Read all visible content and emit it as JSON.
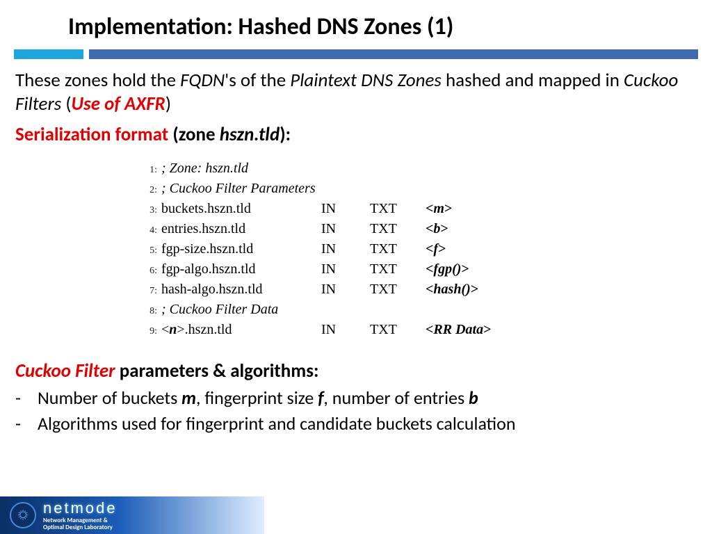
{
  "title": "Implementation: Hashed DNS Zones (1)",
  "intro": {
    "t1": "These zones hold the ",
    "fqdn": "FQDN",
    "t2": "'s of the ",
    "pdz": "Plaintext DNS Zones",
    "t3": " hashed and mapped in ",
    "cf": "Cuckoo Filters",
    "t4": " (",
    "axfr": "Use of AXFR",
    "t5": ")"
  },
  "subhead": {
    "s1": "Serialization format",
    "s2": " (zone ",
    "zone": "hszn.tld",
    "s3": "):"
  },
  "records": [
    {
      "n": "1",
      "comment": true,
      "name": "; Zone: hszn.tld"
    },
    {
      "n": "2",
      "comment": true,
      "name": "; Cuckoo Filter Parameters"
    },
    {
      "n": "3",
      "name": "buckets.hszn.tld",
      "cls": "IN",
      "typ": "TXT",
      "val": "m"
    },
    {
      "n": "4",
      "name": "entries.hszn.tld",
      "cls": "IN",
      "typ": "TXT",
      "val": "b"
    },
    {
      "n": "5",
      "name": "fgp-size.hszn.tld",
      "cls": "IN",
      "typ": "TXT",
      "val": "f"
    },
    {
      "n": "6",
      "name": "fgp-algo.hszn.tld",
      "cls": "IN",
      "typ": "TXT",
      "val": "fgp()"
    },
    {
      "n": "7",
      "name": "hash-algo.hszn.tld",
      "cls": "IN",
      "typ": "TXT",
      "val": "hash()"
    },
    {
      "n": "8",
      "comment": true,
      "name": "; Cuckoo Filter Data"
    },
    {
      "n": "9",
      "raw_name": true,
      "pre": "<",
      "mid": "n",
      "post": ">.hszn.tld",
      "cls": "IN",
      "typ": "TXT",
      "val": "RR Data"
    }
  ],
  "params_head": {
    "cf": "Cuckoo Filter",
    "rest": " parameters & algorithms:"
  },
  "bullets": [
    {
      "parts": [
        {
          "t": "Number of buckets "
        },
        {
          "bi": "m"
        },
        {
          "t": ", fingerprint size "
        },
        {
          "bi": "f"
        },
        {
          "t": ", number of entries "
        },
        {
          "bi": "b"
        }
      ]
    },
    {
      "parts": [
        {
          "t": "Algorithms used for fingerprint and candidate buckets calculation"
        }
      ]
    }
  ],
  "footer": {
    "logo": "netmode",
    "sub1": "Network Management &",
    "sub2": "Optimal Design Laboratory"
  }
}
